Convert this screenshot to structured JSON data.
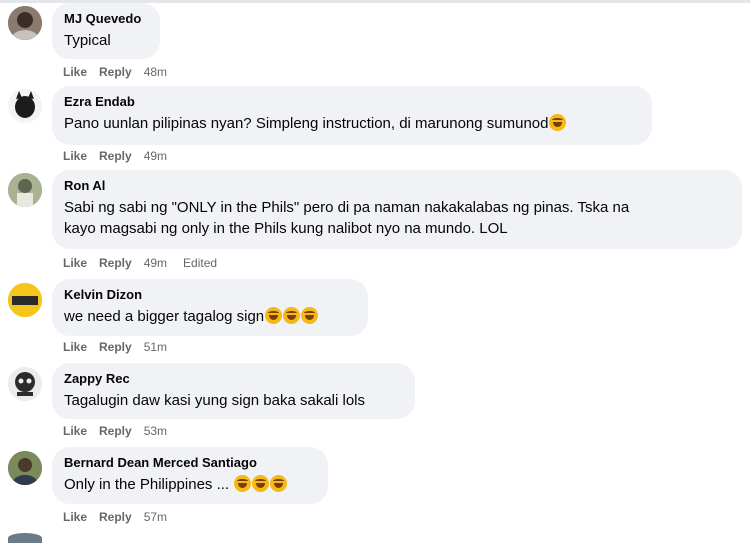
{
  "comments": [
    {
      "name": "MJ Quevedo",
      "text": "Typical",
      "like": "Like",
      "reply": "Reply",
      "time": "48m",
      "edited": "",
      "avatar": "avatar-mj-quevedo",
      "emojis": 0
    },
    {
      "name": "Ezra Endab",
      "text": "Pano uunlan pilipinas nyan? Simpleng instruction, di marunong sumunod",
      "like": "Like",
      "reply": "Reply",
      "time": "49m",
      "edited": "",
      "avatar": "avatar-ezra-endab",
      "emojis": 1
    },
    {
      "name": "Ron Al",
      "text": "Sabi ng sabi ng \"ONLY in the Phils\" pero di pa naman nakakalabas ng pinas. Tska na",
      "text2": "kayo magsabi ng only in the Phils kung nalibot nyo na mundo. LOL",
      "like": "Like",
      "reply": "Reply",
      "time": "49m",
      "edited": "Edited",
      "avatar": "avatar-ron-al",
      "emojis": 0
    },
    {
      "name": "Kelvin Dizon",
      "text": "we need a bigger tagalog sign",
      "like": "Like",
      "reply": "Reply",
      "time": "51m",
      "edited": "",
      "avatar": "avatar-kelvin-dizon",
      "avatar_text": "BODY",
      "emojis": 3
    },
    {
      "name": "Zappy Rec",
      "text": "Tagalugin daw kasi yung sign baka sakali lols",
      "like": "Like",
      "reply": "Reply",
      "time": "53m",
      "edited": "",
      "avatar": "avatar-zappy-rec",
      "emojis": 0
    },
    {
      "name": "Bernard Dean Merced Santiago",
      "text": "Only in the Philippines ...",
      "like": "Like",
      "reply": "Reply",
      "time": "57m",
      "edited": "",
      "avatar": "avatar-bernard-santiago",
      "emojis": 3
    }
  ],
  "colors": {
    "bubble": "#f0f2f5",
    "meta": "#65676b",
    "emoji": "#f5b916"
  }
}
